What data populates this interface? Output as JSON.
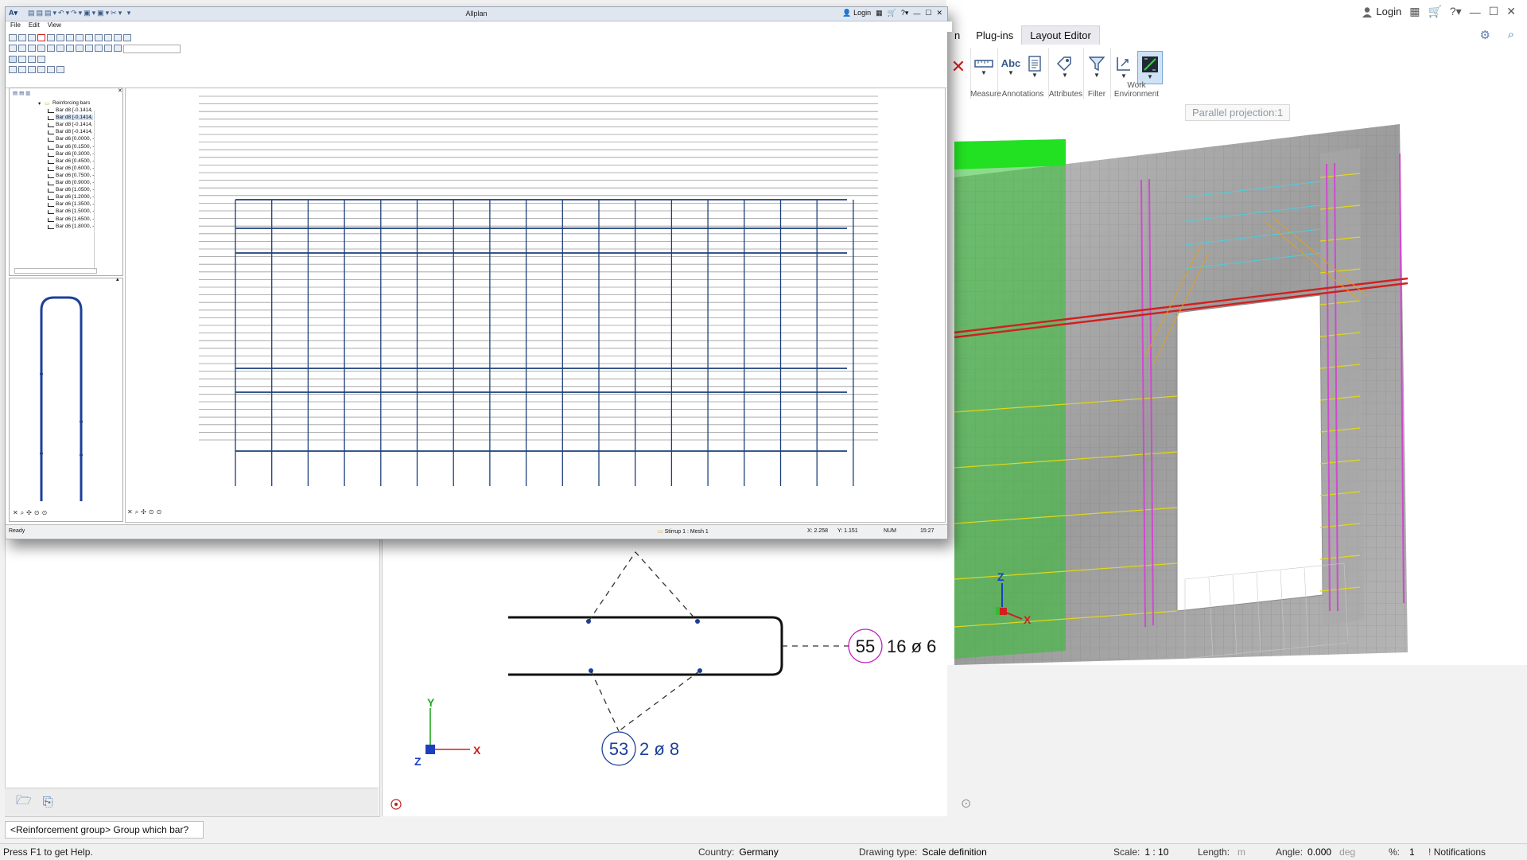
{
  "main": {
    "title_controls": {
      "login_label": "Login"
    },
    "tabs": [
      {
        "label": "n"
      },
      {
        "label": "Plug-ins"
      },
      {
        "label": "Layout Editor"
      }
    ],
    "ribbon_groups": [
      {
        "label": "Measure",
        "icon": "ruler-icon"
      },
      {
        "label": "Annotations",
        "icon": "abc-text-icon"
      },
      {
        "label": "Attributes",
        "icon": "attributes-icon"
      },
      {
        "label": "Filter",
        "icon": "filter-icon"
      },
      {
        "label": "Work Environment",
        "icon": "work-environment-icon"
      }
    ],
    "viewport_label": "Parallel projection:1",
    "axes_3d": {
      "z": "Z",
      "x": "X"
    }
  },
  "detail": {
    "label_55": {
      "number": "55",
      "text": "16 ø 6"
    },
    "label_53": {
      "number": "53",
      "text": "2 ø 8"
    },
    "axes": {
      "y": "Y",
      "x": "X",
      "z": "Z"
    }
  },
  "floating_window": {
    "title": "Allplan",
    "login_label": "Login",
    "menu": [
      "File",
      "Edit",
      "View"
    ],
    "tree": {
      "root": "Reinforcing bars",
      "items": [
        "Bar d8 [-0.1414,",
        "Bar d8 [-0.1414,",
        "Bar d8 [-0.1414,",
        "Bar d8 [-0.1414,",
        "Bar d6 [0.0000, -",
        "Bar d6 [0.1500, -",
        "Bar d6 [0.3000, -",
        "Bar d6 [0.4500, -",
        "Bar d6 [0.6000, -",
        "Bar d6 [0.7500, -",
        "Bar d6 [0.9000, -",
        "Bar d6 [1.0500, -",
        "Bar d6 [1.2000, -",
        "Bar d6 [1.3500, -",
        "Bar d6 [1.5000, -",
        "Bar d6 [1.6500, -",
        "Bar d6 [1.8000, -"
      ],
      "selected_index": 1
    },
    "status": {
      "ready": "Ready",
      "selection": "Stirrup 1 : Mesh 1",
      "x": "X: 2.258",
      "y": "Y: 1.151",
      "num": "NUM",
      "time": "15:27"
    }
  },
  "command_prompt": "<Reinforcement group> Group which bar?",
  "status_bar": {
    "help": "Press F1 to get Help.",
    "country_label": "Country:",
    "country": "Germany",
    "drawing_type_label": "Drawing type:",
    "drawing_type": "Scale definition",
    "scale_label": "Scale:",
    "scale": "1 : 10",
    "length_label": "Length:",
    "length_unit": "m",
    "angle_label": "Angle:",
    "angle": "0.000",
    "angle_unit": "deg",
    "percent_label": "%:",
    "percent": "1",
    "notifications": "Notifications"
  },
  "colors": {
    "accent": "#2a5c9a",
    "mesh_line": "#1c3f7a",
    "green_element": "#22e022",
    "magenta_bar": "#d04ad0",
    "red_bar": "#d02020",
    "yellow_bar": "#e0d81a",
    "cyan_bar": "#4ad0e0"
  }
}
